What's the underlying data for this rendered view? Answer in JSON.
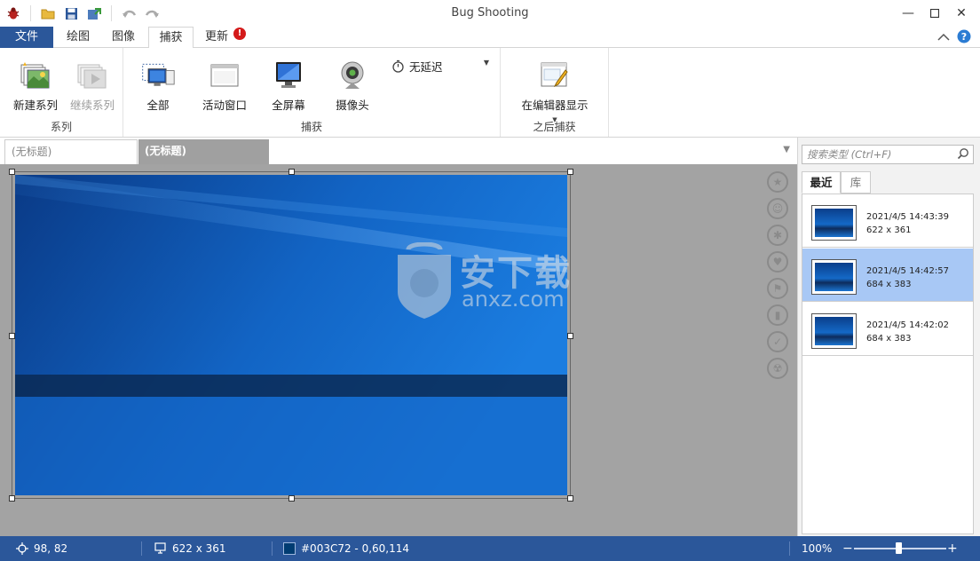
{
  "window": {
    "title": "Bug Shooting"
  },
  "ribbon_tabs": [
    {
      "label": "文件"
    },
    {
      "label": "绘图"
    },
    {
      "label": "图像"
    },
    {
      "label": "捕获"
    },
    {
      "label": "更新"
    }
  ],
  "alert_badge": "!",
  "ribbon": {
    "series_group": {
      "label": "系列",
      "new_series": "新建系列",
      "continue_series": "继续系列"
    },
    "capture_group": {
      "label": "捕获",
      "all": "全部",
      "active_window": "活动窗口",
      "full_screen": "全屏幕",
      "camera": "摄像头",
      "delay": "无延迟"
    },
    "after_group": {
      "label": "之后捕获",
      "show_in_editor": "在编辑器显示"
    }
  },
  "doc_tabs": [
    {
      "label": "(无标题)"
    },
    {
      "label": "(无标题)"
    }
  ],
  "watermark": {
    "line1": "安下载",
    "line2": "anxz.com"
  },
  "right_panel": {
    "search_placeholder": "搜索类型 (Ctrl+F)",
    "tabs": [
      {
        "label": "最近"
      },
      {
        "label": "库"
      }
    ],
    "items": [
      {
        "timestamp": "2021/4/5 14:43:39",
        "size": "622 x 361"
      },
      {
        "timestamp": "2021/4/5 14:42:57",
        "size": "684 x 383"
      },
      {
        "timestamp": "2021/4/5 14:42:02",
        "size": "684 x 383"
      }
    ],
    "selected_index": 1
  },
  "status": {
    "cursor": "98, 82",
    "dimensions": "622 x 361",
    "color_text": "#003C72 - 0,60,114",
    "zoom": "100%",
    "zoom_minus": "−",
    "zoom_plus": "+"
  },
  "colors": {
    "accent": "#2b579a",
    "selected_item": "#a8c8f5",
    "picked_color": "#003c72"
  }
}
